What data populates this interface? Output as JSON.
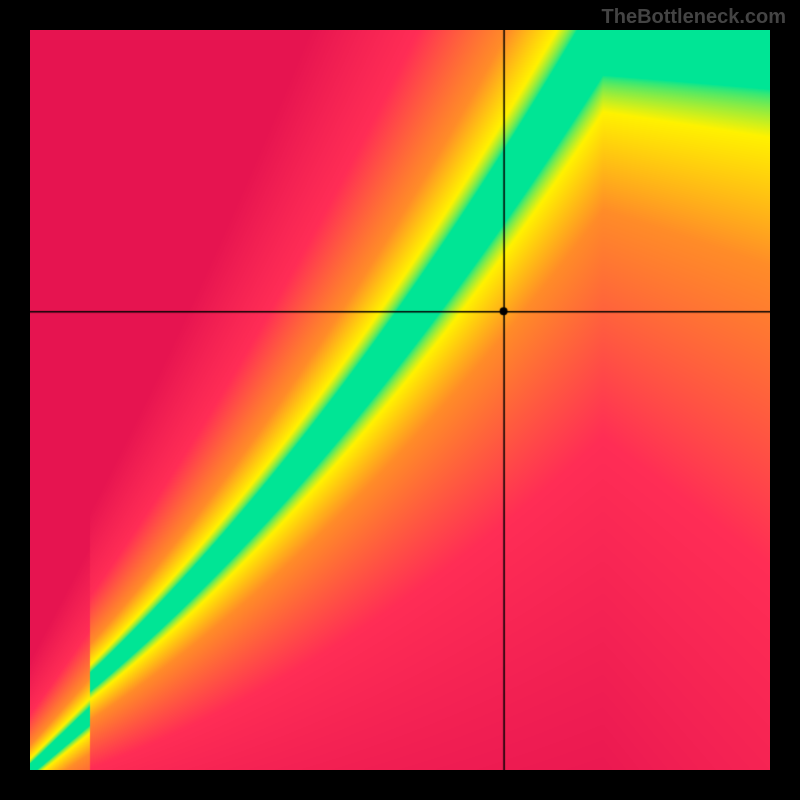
{
  "watermark": "TheBottleneck.com",
  "chart_data": {
    "type": "heatmap",
    "title": "",
    "xlabel": "",
    "ylabel": "",
    "xlim": [
      0,
      100
    ],
    "ylim": [
      0,
      100
    ],
    "crosshair": {
      "x": 64,
      "y": 62
    },
    "marker": {
      "x": 64,
      "y": 62,
      "radius": 4
    },
    "optimal_curve_description": "A green diagonal band from bottom-left to upper-right indicating optimal balance; surrounded by yellow transition zones fading to orange and red at the extremes",
    "color_scale": {
      "optimal": "#00e595",
      "good": "#fff200",
      "warning": "#ff9933",
      "poor": "#ff3355"
    },
    "grid": false,
    "axes_visible": false
  }
}
